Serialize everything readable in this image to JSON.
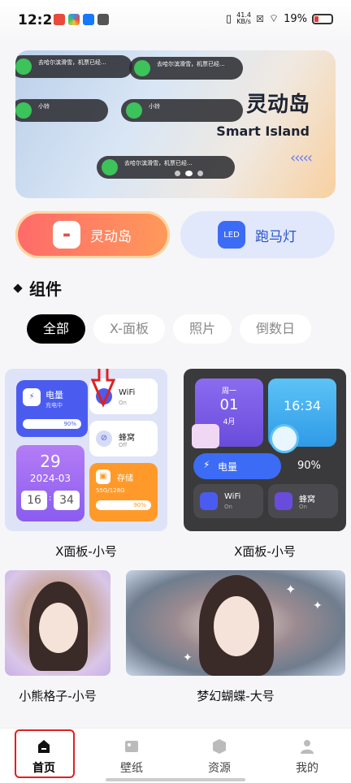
{
  "status": {
    "time": "12:21",
    "net_speed": "41.4",
    "net_unit": "KB/s",
    "battery": "19%"
  },
  "banner": {
    "title": "灵动岛",
    "subtitle": "Smart Island",
    "chevrons": "‹‹‹‹‹",
    "pills": [
      {
        "text": "去哈尔滨滑雪，机票已经..."
      },
      {
        "text": "去哈尔滨滑雪，机票已经..."
      },
      {
        "text": "小铃"
      },
      {
        "text": "小铃"
      },
      {
        "text": "去哈尔滨滑雪，机票已经..."
      }
    ]
  },
  "modes": {
    "island_label": "灵动岛",
    "marquee_label": "跑马灯",
    "marquee_icon_text": "LED"
  },
  "section": {
    "title": "组件"
  },
  "filters": [
    "全部",
    "X-面板",
    "照片",
    "倒数日"
  ],
  "widgets_light": {
    "battery_title": "电量",
    "battery_sub": "充电中",
    "battery_pct": "90%",
    "wifi": "WiFi",
    "wifi_state": "On",
    "cellular": "蜂窝",
    "cellular_state": "Off",
    "day": "29",
    "date": "2024-03",
    "clock_h": "16",
    "clock_m": "34",
    "storage": "存储",
    "storage_detail": "55G/128G",
    "storage_pct": "90%"
  },
  "widgets_dark": {
    "weekday": "周一",
    "day": "01",
    "month": "4月",
    "time": "16:34",
    "battery": "电量",
    "battery_pct": "90%",
    "wifi": "WiFi",
    "wifi_state": "On",
    "cellular": "蜂窝",
    "cellular_state": "On"
  },
  "cards": {
    "card1_label": "X面板-小号",
    "card2_label": "X面板-小号",
    "card3_label": "小熊格子-小号",
    "card4_label": "梦幻蝴蝶-大号"
  },
  "tabs": [
    "首页",
    "壁纸",
    "资源",
    "我的"
  ],
  "colors": {
    "accent_red": "#e02020",
    "island_gradient": "#ff6a6a",
    "marquee_blue": "#3c6cf5"
  }
}
